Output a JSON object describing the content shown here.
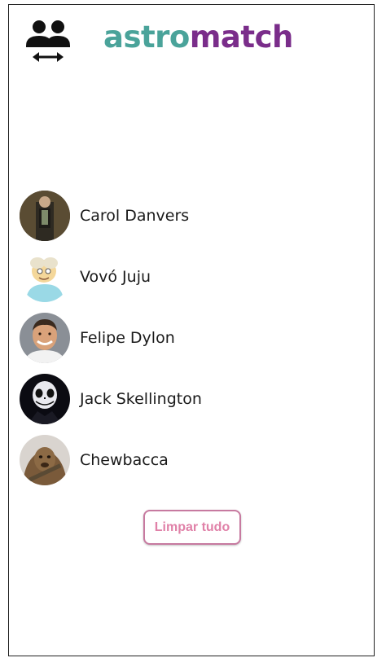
{
  "header": {
    "logo_part1": "astro",
    "logo_part2": "match",
    "toggle_icon": "people-switch-icon",
    "accent_teal": "#4aa39a",
    "accent_purple": "#7a2d8a"
  },
  "matches": [
    {
      "name": "Carol Danvers",
      "avatar": "carol-danvers-avatar"
    },
    {
      "name": "Vovó Juju",
      "avatar": "vovo-juju-avatar"
    },
    {
      "name": "Felipe Dylon",
      "avatar": "felipe-dylon-avatar"
    },
    {
      "name": "Jack Skellington",
      "avatar": "jack-skellington-avatar"
    },
    {
      "name": "Chewbacca",
      "avatar": "chewbacca-avatar"
    }
  ],
  "actions": {
    "clear_label": "Limpar tudo",
    "clear_color": "#e081a8"
  }
}
